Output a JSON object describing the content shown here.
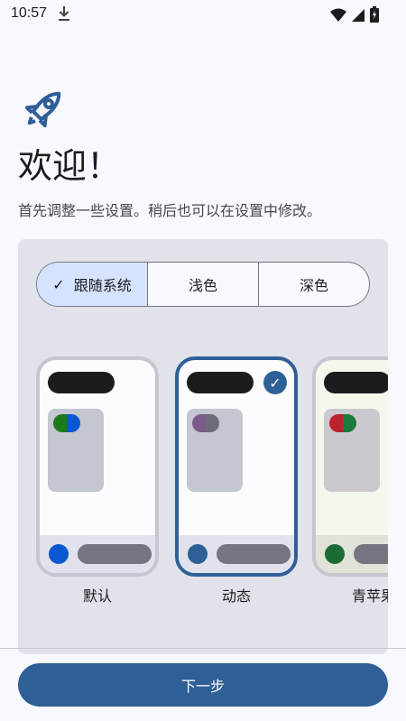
{
  "status": {
    "time": "10:57",
    "icons": [
      "download-icon",
      "wifi-icon",
      "cell-signal-icon",
      "battery-icon"
    ]
  },
  "header": {
    "title": "欢迎！",
    "subtitle": "首先调整一些设置。稍后也可以在设置中修改。"
  },
  "mode": {
    "options": [
      "跟随系统",
      "浅色",
      "深色"
    ],
    "selected": "跟随系统"
  },
  "themes": [
    {
      "label": "默认",
      "selected": false,
      "chip": [
        "#1b7b1b",
        "#0b57d0"
      ],
      "dot": "#0b57d0"
    },
    {
      "label": "动态",
      "selected": true,
      "chip": [
        "#7d5b8d",
        "#6a6d78"
      ],
      "dot": "#2f5f97"
    },
    {
      "label": "青苹果",
      "selected": false,
      "chip": [
        "#c0212f",
        "#1b7b3a"
      ],
      "dot": "#1b6b35"
    }
  ],
  "footer": {
    "next_label": "下一步"
  },
  "colors": {
    "primary": "#2f5f97",
    "background": "#f8f9ff",
    "panel": "#e1e2ea"
  }
}
